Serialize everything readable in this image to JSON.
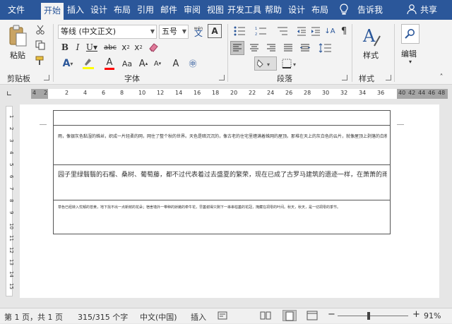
{
  "tabs": [
    "文件",
    "开始",
    "插入",
    "设计",
    "布局",
    "引用",
    "邮件",
    "审阅",
    "视图",
    "开发工具",
    "帮助",
    "设计",
    "布局"
  ],
  "active_tab": "开始",
  "tell_me": "告诉我",
  "share": "共享",
  "ribbon": {
    "clipboard": {
      "paste": "粘贴",
      "label": "剪贴板"
    },
    "font": {
      "name": "等线 (中文正文)",
      "size": "五号",
      "label": "字体",
      "wen": "wén",
      "a_label": "A",
      "aa_label": "Aa"
    },
    "paragraph": {
      "label": "段落"
    },
    "styles": {
      "button": "样式",
      "label": "样式"
    },
    "editing": {
      "button": "编辑"
    }
  },
  "ruler": {
    "left_ticks": [
      "4",
      "2"
    ],
    "ticks": [
      "2",
      "4",
      "6",
      "8",
      "10",
      "12",
      "14",
      "16",
      "18",
      "20",
      "22",
      "24",
      "26",
      "28",
      "30",
      "32",
      "34",
      "36"
    ],
    "right_ticks": [
      "40",
      "42",
      "44",
      "46",
      "48"
    ]
  },
  "vruler_ticks": [
    "1",
    "2",
    "3",
    "4",
    "5",
    "6",
    "7",
    "8",
    "9",
    "10",
    "11",
    "12",
    "13",
    "14",
    "15"
  ],
  "document": {
    "row1": "雨，像银灰色黏湿的蛛丝，织成一片轻柔的网，网住了整个秋的世界。天色是暗沉沉的，像古老的住宅里缠满着蛛网的屋顶。那堆在天上的灰白色的云片，就像屋顶上剥落的白粉。在这古旧的屋顶下，一切都是那样的沉闷。",
    "row2": "园子里绿翳翳的石榴、桑树、葡萄藤，都不过代表着过去盛夏的繁荣，现在已成了古罗马建筑的遗迹一样，在萧萧的雨声中瑟缩不宁，回忆着光荣的过去。",
    "row3": "草色已经转入忧郁的苍黄，地下找不出一点新鲜的花朵；宿舍墙外一带种的娇嫩的牵牛花，早萎谢得只剩下一串串枯萎的花冠，掩藏在凋零的叶间。秋天，秋天，是一切凋零的季节。"
  },
  "status": {
    "page": "第 1 页，共 1 页",
    "words": "315/315 个字",
    "lang": "中文(中国)",
    "mode": "插入",
    "zoom": "91%",
    "minus": "−",
    "plus": "+"
  },
  "colors": {
    "accent": "#2b579a",
    "highlight": "#ffff00",
    "font_color": "#ff0000"
  },
  "icons": [
    "lightbulb-icon",
    "user-icon",
    "paste-icon",
    "cut-icon",
    "copy-icon",
    "format-painter-icon",
    "bold-icon",
    "italic-icon",
    "underline-icon",
    "strikethrough-icon",
    "subscript-icon",
    "superscript-icon",
    "eraser-icon",
    "text-effects-icon",
    "highlight-icon",
    "font-color-icon",
    "grow-font-icon",
    "shrink-font-icon",
    "bullets-icon",
    "numbering-icon",
    "multilevel-icon",
    "indent-icon",
    "outdent-icon",
    "sort-icon",
    "pilcrow-icon",
    "align-left-icon",
    "center-icon",
    "align-right-icon",
    "justify-icon",
    "distributed-icon",
    "line-spacing-icon",
    "shading-icon",
    "borders-icon",
    "styles-icon",
    "search-icon"
  ]
}
